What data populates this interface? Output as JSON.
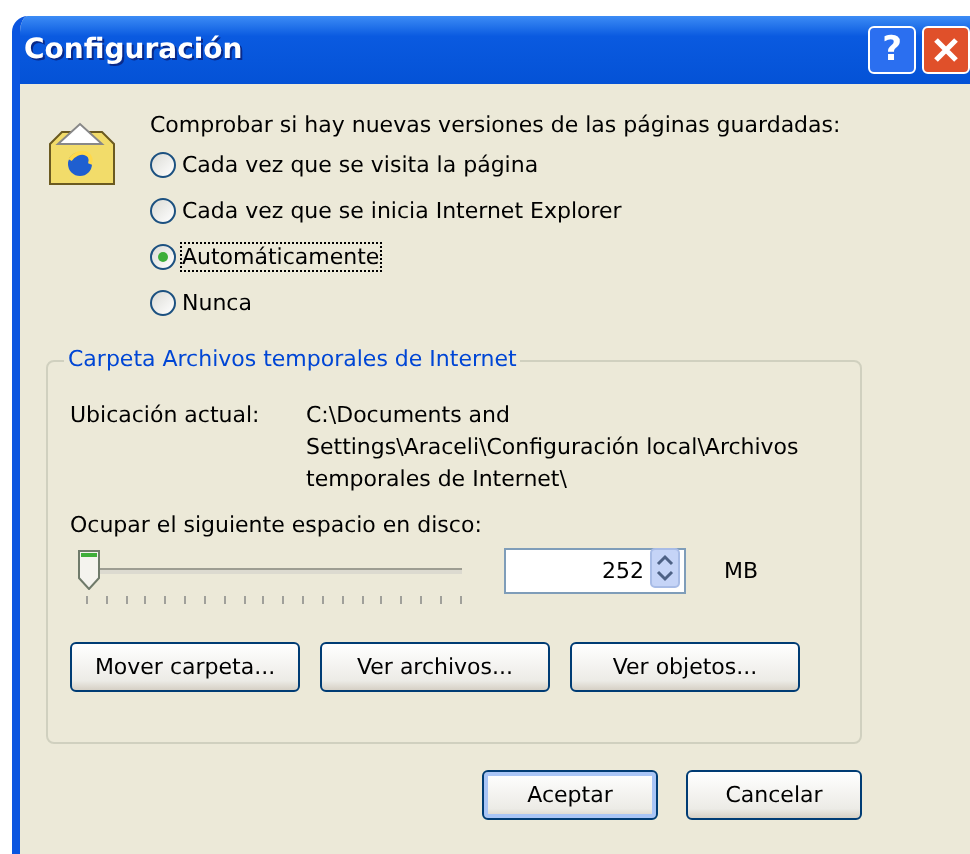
{
  "window": {
    "title": "Configuración"
  },
  "title_buttons": [
    {
      "kind": "help",
      "label": "?"
    },
    {
      "kind": "close"
    }
  ],
  "check_label": "Comprobar si hay nuevas versiones de las páginas guardadas:",
  "options": [
    {
      "label": "Cada vez que se visita la página",
      "selected": false
    },
    {
      "label": "Cada vez que se inicia Internet Explorer",
      "selected": false
    },
    {
      "label": "Automáticamente",
      "selected": true
    },
    {
      "label": "Nunca",
      "selected": false
    }
  ],
  "group": {
    "title": "Carpeta Archivos temporales de Internet",
    "location_label": "Ubicación actual:",
    "location_value": "C:\\Documents and Settings\\Araceli\\Configuración local\\Archivos temporales de Internet\\",
    "space_label": "Ocupar el siguiente espacio en disco:",
    "slider": {
      "level": 0.02
    },
    "size": {
      "value": "252",
      "unit": "MB"
    },
    "buttons": [
      "Mover carpeta...",
      "Ver archivos...",
      "Ver objetos..."
    ]
  },
  "buttons": [
    {
      "label": "Aceptar",
      "default": true
    },
    {
      "label": "Cancelar",
      "default": false
    }
  ]
}
